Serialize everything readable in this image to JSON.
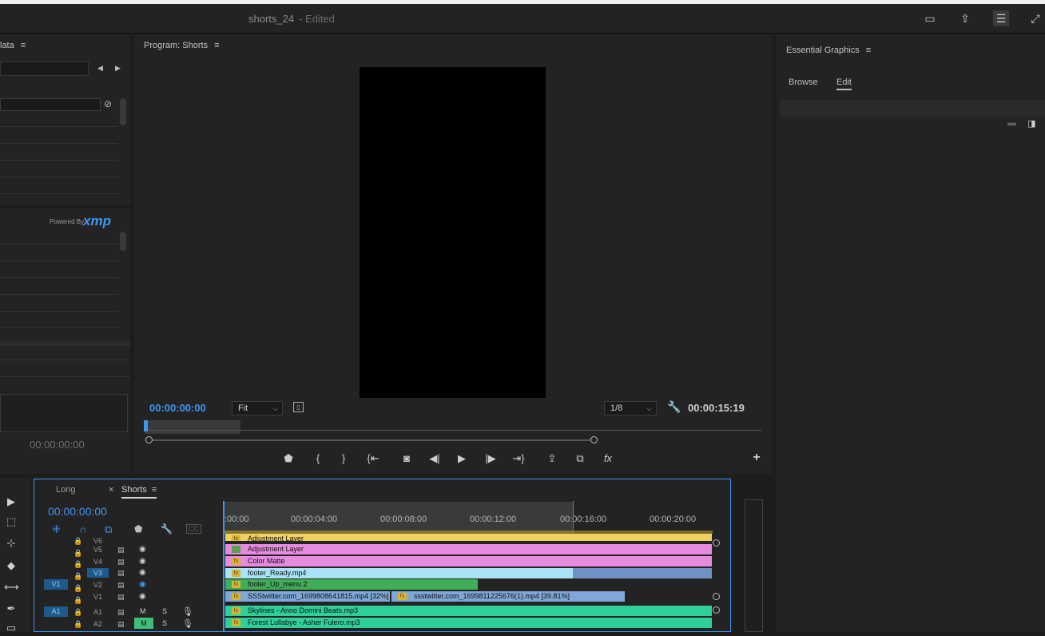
{
  "title": {
    "name": "shorts_24",
    "edited": "- Edited"
  },
  "metadata_panel": {
    "tab": "lata",
    "powered_by": "Powered By",
    "xmp": "xmp",
    "timecode": "00:00:00:00"
  },
  "program": {
    "title": "Program: Shorts",
    "current_time": "00:00:00:00",
    "fit": "Fit",
    "resolution": "1/8",
    "duration": "00:00:15:19"
  },
  "essential_graphics": {
    "title": "Essential Graphics",
    "tabs": [
      "Browse",
      "Edit"
    ],
    "active_tab": "Edit"
  },
  "timeline": {
    "tabs": [
      "Long",
      "Shorts"
    ],
    "active_tab": "Shorts",
    "close": "×",
    "timecode": "00:00:00:00",
    "ruler": [
      ":00:00",
      "00:00:04:00",
      "00:00:08:00",
      "00:00:12:00",
      "00:00:16:00",
      "00:00:20:00"
    ],
    "tracks": [
      {
        "name": "V6"
      },
      {
        "name": "V5"
      },
      {
        "name": "V4"
      },
      {
        "name": "V3"
      },
      {
        "name": "V2"
      },
      {
        "name": "V1"
      },
      {
        "name": "A1"
      },
      {
        "name": "A2"
      }
    ],
    "src_v1": "V1",
    "src_a1": "A1",
    "m_label": "M",
    "s_label": "S",
    "clips": [
      "Adjustment Layer",
      "Adjustment Layer",
      "Color Matte",
      "footer_Ready.mp4",
      "footer_Up_menu 2",
      "SSStwitter.com_1699808641815.mp4 [32%]",
      "ssstwitter.com_1699811225676(1).mp4 [39.81%]",
      "Skylines - Anno Domini Beats.mp3",
      "Forest Lullabye - Asher Fulero.mp3"
    ],
    "fx": "fx"
  },
  "colors": {
    "accent": "#3e96f0",
    "pink": "#e68be0",
    "cyan": "#a9e3f5",
    "green": "#3fae57",
    "blue": "#7fa7d8",
    "audio": "#2fcf99"
  }
}
